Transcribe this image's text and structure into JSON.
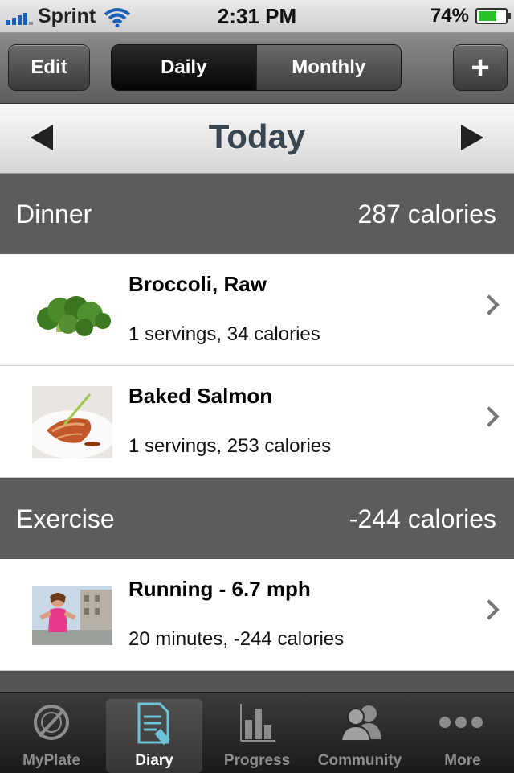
{
  "status_bar": {
    "carrier": "Sprint",
    "time": "2:31 PM",
    "battery": "74%",
    "battery_level": 0.74
  },
  "toolbar": {
    "edit_label": "Edit",
    "segments": [
      {
        "label": "Daily",
        "selected": true
      },
      {
        "label": "Monthly",
        "selected": false
      }
    ],
    "add_label": "+"
  },
  "date_bar": {
    "title": "Today"
  },
  "sections": [
    {
      "name": "Dinner",
      "calories": "287 calories",
      "items": [
        {
          "title": "Broccoli, Raw",
          "detail": "1 servings, 34 calories",
          "image": "broccoli-photo"
        },
        {
          "title": "Baked Salmon",
          "detail": "1 servings, 253 calories",
          "image": "salmon-photo"
        }
      ]
    },
    {
      "name": "Exercise",
      "calories": "-244 calories",
      "items": [
        {
          "title": "Running - 6.7 mph",
          "detail": "20 minutes, -244 calories",
          "image": "runner-photo"
        }
      ]
    }
  ],
  "tabs": [
    {
      "label": "MyPlate",
      "icon": "plate-fork-icon",
      "active": false
    },
    {
      "label": "Diary",
      "icon": "diary-icon",
      "active": true
    },
    {
      "label": "Progress",
      "icon": "bar-chart-icon",
      "active": false
    },
    {
      "label": "Community",
      "icon": "people-icon",
      "active": false
    },
    {
      "label": "More",
      "icon": "more-dots-icon",
      "active": false
    }
  ],
  "colors": {
    "accent_tab_icon": "#6fc3d6",
    "section_bg": "#5c5c5c",
    "battery_green": "#2dc02d"
  }
}
